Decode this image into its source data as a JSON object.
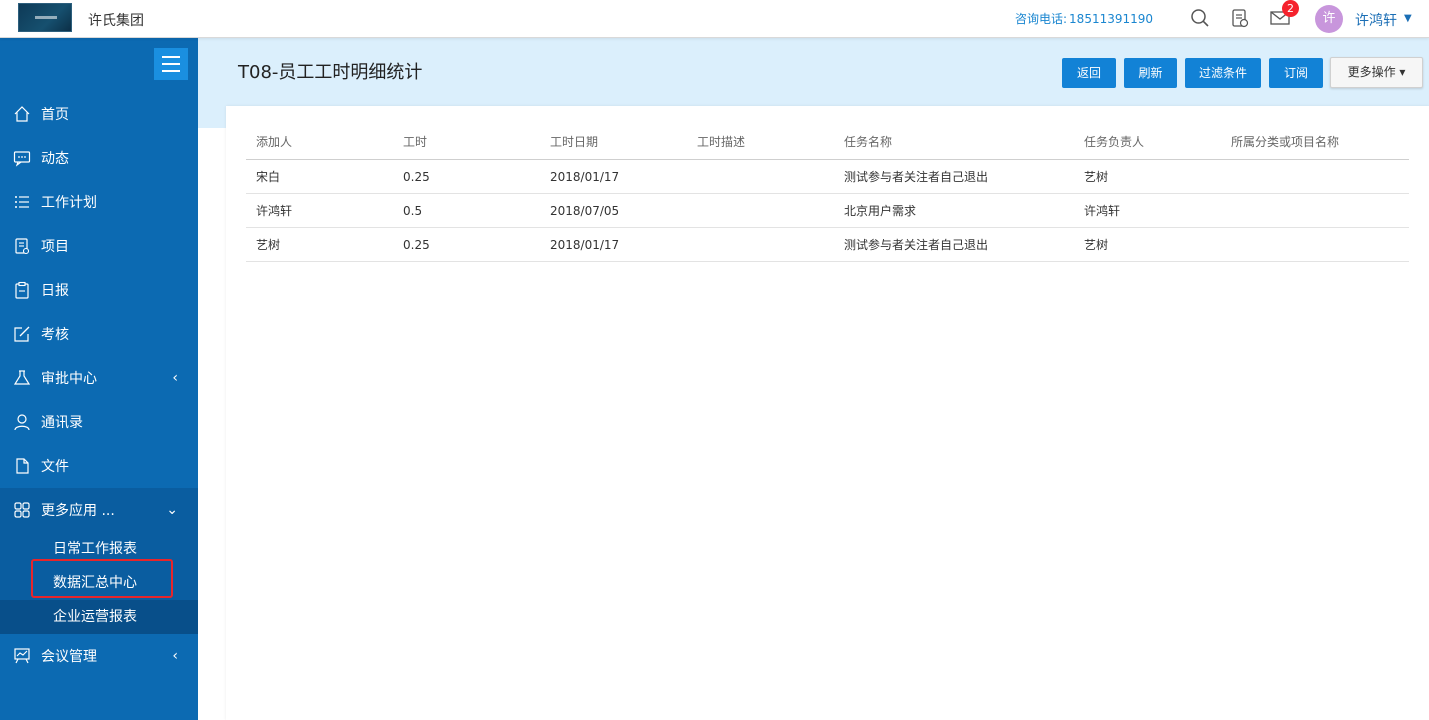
{
  "header": {
    "company": "许氏集团",
    "hotline_label": "咨询电话:",
    "hotline_number": "18511391190",
    "messages_badge": "2",
    "avatar_char": "许",
    "username": "许鸿轩",
    "user_caret": "▼"
  },
  "sidebar": {
    "items": [
      {
        "label": "首页",
        "icon": "home-icon"
      },
      {
        "label": "动态",
        "icon": "chat-icon"
      },
      {
        "label": "工作计划",
        "icon": "list-icon"
      },
      {
        "label": "项目",
        "icon": "project-icon"
      },
      {
        "label": "日报",
        "icon": "clipboard-icon"
      },
      {
        "label": "考核",
        "icon": "edit-icon"
      },
      {
        "label": "审批中心",
        "icon": "flask-icon",
        "arrow": "‹"
      },
      {
        "label": "通讯录",
        "icon": "user-icon"
      },
      {
        "label": "文件",
        "icon": "file-icon"
      },
      {
        "label": "更多应用 ...",
        "icon": "apps-icon",
        "arrow": "⌄"
      },
      {
        "label": "会议管理",
        "icon": "meeting-icon",
        "arrow": "‹"
      }
    ],
    "sub_items": [
      {
        "label": "日常工作报表"
      },
      {
        "label": "数据汇总中心"
      },
      {
        "label": "企业运营报表"
      }
    ]
  },
  "page": {
    "title": "T08-员工工时明细统计",
    "buttons": {
      "back": "返回",
      "refresh": "刷新",
      "filter": "过滤条件",
      "subscribe": "订阅",
      "more": "更多操作 ▾"
    }
  },
  "table": {
    "columns": [
      "添加人",
      "工时",
      "工时日期",
      "工时描述",
      "任务名称",
      "任务负责人",
      "所属分类或项目名称"
    ],
    "rows": [
      [
        "宋白",
        "0.25",
        "2018/01/17",
        "",
        "测试参与者关注者自己退出",
        "艺树",
        ""
      ],
      [
        "许鸿轩",
        "0.5",
        "2018/07/05",
        "",
        "北京用户需求",
        "许鸿轩",
        ""
      ],
      [
        "艺树",
        "0.25",
        "2018/01/17",
        "",
        "测试参与者关注者自己退出",
        "艺树",
        ""
      ]
    ]
  },
  "colors": {
    "sidebar": "#0c6ab2",
    "accent": "#1282d6",
    "header_band": "#dbeffc",
    "badge": "#f5222d",
    "highlight_box": "#e8252a"
  }
}
